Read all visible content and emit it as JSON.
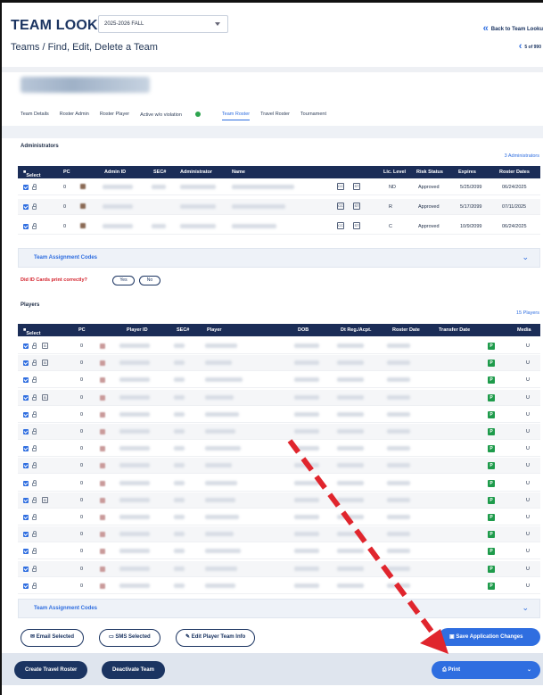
{
  "header": {
    "title": "TEAM LOOKUP",
    "season": "2025-2026 FALL",
    "subtitle": "Teams / Find, Edit, Delete a Team",
    "back_link": "Back to Team Looku",
    "pager": "5 of 990"
  },
  "tabs": [
    {
      "label": "Team Details"
    },
    {
      "label": "Roster Admin"
    },
    {
      "label": "Roster Player"
    },
    {
      "label": "Active w/o violation"
    },
    {
      "label": "Team Roster"
    },
    {
      "label": "Travel Roster"
    },
    {
      "label": "Tournament"
    }
  ],
  "administrators": {
    "title": "Administrators",
    "count": "3 Administrators",
    "columns": [
      "Select",
      "PC",
      "Admin ID",
      "SEC#",
      "Administrator",
      "Name",
      "Lic. Level",
      "Risk Status",
      "Expires",
      "Roster Dates"
    ],
    "rows": [
      {
        "pc": "0",
        "lic": "ND",
        "risk": "Approved",
        "expires": "5/25/2099",
        "roster": "06/24/2025"
      },
      {
        "pc": "0",
        "lic": "R",
        "risk": "Approved",
        "expires": "5/17/2099",
        "roster": "07/11/2025"
      },
      {
        "pc": "0",
        "lic": "C",
        "risk": "Approved",
        "expires": "10/9/2099",
        "roster": "06/24/2025"
      }
    ],
    "doc_tags": [
      "CC",
      "ST"
    ]
  },
  "assignment_codes_label": "Team Assignment Codes",
  "id_question": "Did ID Cards print correctly?",
  "yes_label": "Yes",
  "no_label": "No",
  "players": {
    "title": "Players",
    "count": "15 Players",
    "columns": [
      "Select",
      "PC",
      "Player ID",
      "SEC#",
      "Player",
      "DOB",
      "Dt Reg./Acpt.",
      "Roster Date",
      "Transfer Date",
      "Media"
    ],
    "rows": [
      {
        "pc": "0",
        "b": true,
        "media": "U"
      },
      {
        "pc": "0",
        "b": true,
        "media": "U"
      },
      {
        "pc": "0",
        "b": false,
        "media": "U"
      },
      {
        "pc": "0",
        "b": true,
        "media": "U"
      },
      {
        "pc": "0",
        "b": false,
        "media": "U"
      },
      {
        "pc": "0",
        "b": false,
        "media": "U"
      },
      {
        "pc": "0",
        "b": false,
        "media": "U"
      },
      {
        "pc": "0",
        "b": false,
        "media": "U"
      },
      {
        "pc": "0",
        "b": false,
        "media": "U"
      },
      {
        "pc": "0",
        "b": true,
        "media": "U"
      },
      {
        "pc": "0",
        "b": false,
        "media": "U"
      },
      {
        "pc": "0",
        "b": false,
        "media": "U"
      },
      {
        "pc": "0",
        "b": false,
        "media": "U"
      },
      {
        "pc": "0",
        "b": false,
        "media": "U"
      },
      {
        "pc": "0",
        "b": false,
        "media": "U"
      }
    ],
    "p_badge": "P",
    "b_badge": "B"
  },
  "actions": {
    "email": "Email Selected",
    "sms": "SMS Selected",
    "edit": "Edit Player Team Info",
    "save": "Save Application Changes",
    "create_travel": "Create Travel Roster",
    "deactivate": "Deactivate Team",
    "print": "Print"
  },
  "colors": {
    "navy": "#1b2d57",
    "accent": "#2f6ee0",
    "alert": "#d3202a",
    "arrow": "#e0252d",
    "green": "#1e9b4b"
  }
}
